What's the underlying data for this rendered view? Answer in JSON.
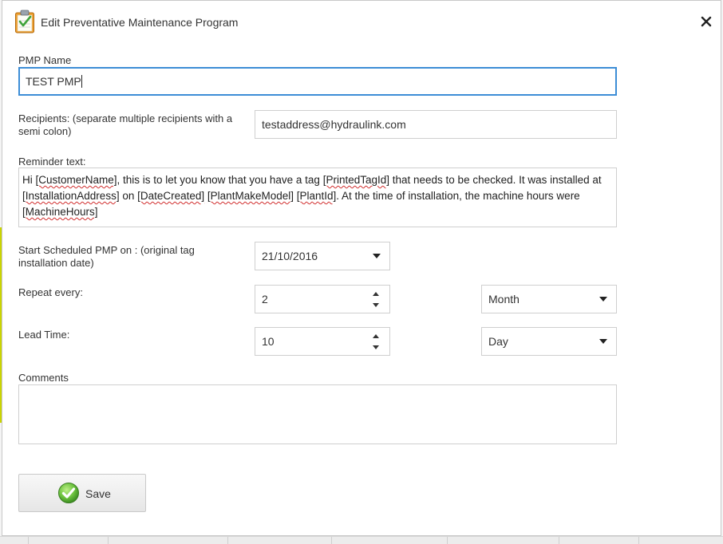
{
  "dialog": {
    "title": "Edit Preventative Maintenance Program",
    "title_icon": "clipboard-check-icon",
    "close_icon": "close-icon"
  },
  "form": {
    "pmp_name": {
      "label": "PMP Name",
      "value": "TEST PMP"
    },
    "recipients": {
      "label": "Recipients: (separate multiple recipients with a semi colon)",
      "value": "testaddress@hydraulink.com"
    },
    "reminder": {
      "label": "Reminder text:",
      "segments": [
        "Hi ",
        "[CustomerName]",
        ", this is to let you know that you have a tag ",
        "[PrintedTagId]",
        " that needs to be checked. It was installed at ",
        "[InstallationAddress]",
        " on ",
        "[DateCreated]",
        " ",
        "[PlantMakeModel]",
        " ",
        "[PlantId]",
        ". At the time of installation, the machine hours were ",
        "[MachineHours]"
      ]
    },
    "start": {
      "label": "Start Scheduled PMP on : (original tag installation date)",
      "value": "21/10/2016"
    },
    "repeat": {
      "label": "Repeat every:",
      "value": "2",
      "unit": "Month"
    },
    "lead_time": {
      "label": "Lead Time:",
      "value": "10",
      "unit": "Day"
    },
    "comments": {
      "label": "Comments",
      "value": ""
    }
  },
  "actions": {
    "save_label": "Save",
    "save_icon": "checkmark-icon"
  },
  "colors": {
    "focus_border": "#3c8dd6",
    "spell_underline": "#d12e2e",
    "save_check_green": "#5fb33a",
    "left_accent": "#c9d400"
  }
}
